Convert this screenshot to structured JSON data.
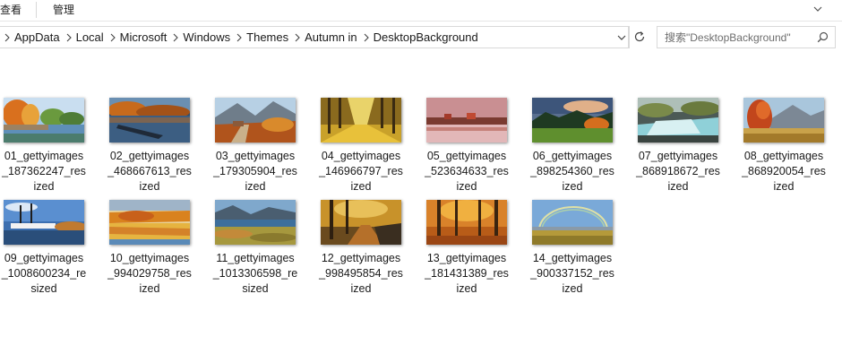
{
  "ribbon": {
    "tabs": [
      "查看",
      "管理"
    ]
  },
  "address": {
    "path": [
      "AppData",
      "Local",
      "Microsoft",
      "Windows",
      "Themes",
      "Autumn in",
      "DesktopBackground"
    ]
  },
  "search": {
    "placeholder": "搜索\"DesktopBackground\""
  },
  "files": [
    {
      "name": "01_gettyimages_187362247_resized",
      "lines": [
        "01_gettyimages",
        "_187362247_res",
        "ized"
      ],
      "scene": "trees-lake"
    },
    {
      "name": "02_gettyimages_468667613_resized",
      "lines": [
        "02_gettyimages",
        "_468667613_res",
        "ized"
      ],
      "scene": "boat-lake"
    },
    {
      "name": "03_gettyimages_179305904_resized",
      "lines": [
        "03_gettyimages",
        "_179305904_res",
        "ized"
      ],
      "scene": "mountain-path"
    },
    {
      "name": "04_gettyimages_146966797_resized",
      "lines": [
        "04_gettyimages",
        "_146966797_res",
        "ized"
      ],
      "scene": "yellow-avenue"
    },
    {
      "name": "05_gettyimages_523634633_resized",
      "lines": [
        "05_gettyimages",
        "_523634633_res",
        "ized"
      ],
      "scene": "pink-sunset-lake"
    },
    {
      "name": "06_gettyimages_898254360_resized",
      "lines": [
        "06_gettyimages",
        "_898254360_res",
        "ized"
      ],
      "scene": "forest-field"
    },
    {
      "name": "07_gettyimages_868918672_resized",
      "lines": [
        "07_gettyimages",
        "_868918672_res",
        "ized"
      ],
      "scene": "waterfall"
    },
    {
      "name": "08_gettyimages_868920054_resized",
      "lines": [
        "08_gettyimages",
        "_868920054_res",
        "ized"
      ],
      "scene": "red-tree-mountain"
    },
    {
      "name": "09_gettyimages_1008600234_resized",
      "lines": [
        "09_gettyimages",
        "_1008600234_re",
        "sized"
      ],
      "scene": "ships-harbor"
    },
    {
      "name": "10_gettyimages_994029758_resized",
      "lines": [
        "10_gettyimages",
        "_994029758_res",
        "ized"
      ],
      "scene": "golden-reflection"
    },
    {
      "name": "11_gettyimages_1013306598_resized",
      "lines": [
        "11_gettyimages",
        "_1013306598_re",
        "sized"
      ],
      "scene": "fjord-meadow"
    },
    {
      "name": "12_gettyimages_998495854_resized",
      "lines": [
        "12_gettyimages",
        "_998495854_res",
        "ized"
      ],
      "scene": "forest-path-fence"
    },
    {
      "name": "13_gettyimages_181431389_resized",
      "lines": [
        "13_gettyimages",
        "_181431389_res",
        "ized"
      ],
      "scene": "beech-forest"
    },
    {
      "name": "14_gettyimages_900337152_resized",
      "lines": [
        "14_gettyimages",
        "_900337152_res",
        "ized"
      ],
      "scene": "rainbow-plain"
    }
  ]
}
